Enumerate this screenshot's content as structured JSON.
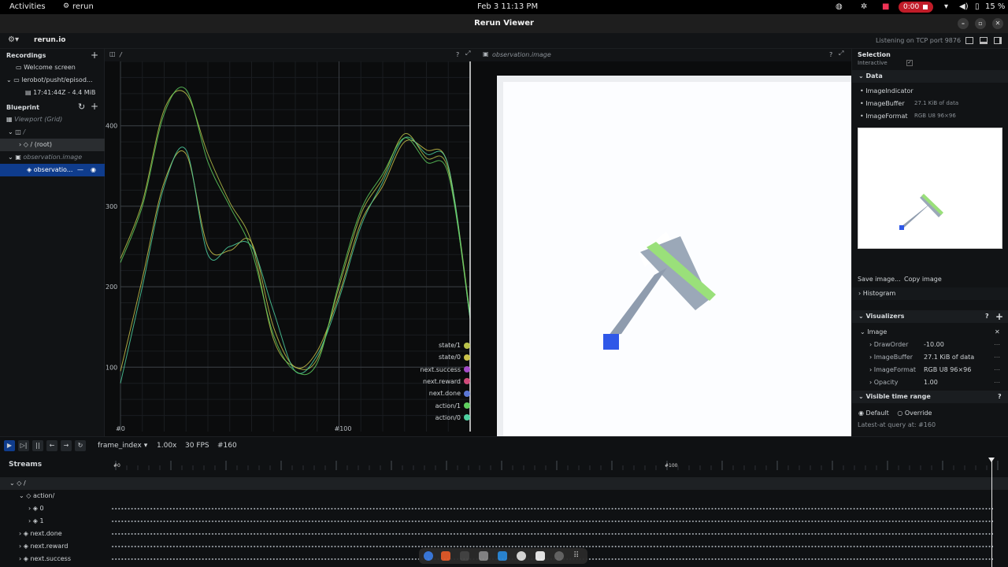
{
  "gnome": {
    "activities": "Activities",
    "app": "rerun",
    "clock": "Feb 3  11:13 PM",
    "recording_timer": "0:00",
    "battery": "15 %"
  },
  "window": {
    "title": "Rerun Viewer"
  },
  "top_panel": {
    "brand": "rerun.io",
    "status": "Listening on TCP port 9876"
  },
  "left_panel": {
    "recordings_title": "Recordings",
    "welcome": "Welcome screen",
    "recording_app": "lerobot/pusht/episod...",
    "recording_info": "17:41:44Z - 4.4 MiB",
    "blueprint_title": "Blueprint",
    "viewport": "Viewport (Grid)",
    "plot_container": "/",
    "plot_root": "/ (root)",
    "image_container": "observation.image",
    "image_entity": "observatio..."
  },
  "plot_view": {
    "tab_title": "/",
    "help": "?",
    "y_ticks": [
      "400",
      "300",
      "200",
      "100"
    ],
    "x_ticks": [
      "#0",
      "#100"
    ],
    "legend": [
      {
        "label": "state/1",
        "color": "#b9c24a"
      },
      {
        "label": "state/0",
        "color": "#c9c24a"
      },
      {
        "label": "next.success",
        "color": "#a44bc9"
      },
      {
        "label": "next.reward",
        "color": "#d04a7a"
      },
      {
        "label": "next.done",
        "color": "#5b77d6"
      },
      {
        "label": "action/1",
        "color": "#5fcf5f"
      },
      {
        "label": "action/0",
        "color": "#4ed0a0"
      }
    ]
  },
  "chart_data": {
    "type": "line",
    "x": [
      0,
      10,
      20,
      30,
      40,
      50,
      60,
      70,
      80,
      90,
      100,
      110,
      120,
      130,
      140,
      150,
      160
    ],
    "ylim": [
      20,
      480
    ],
    "xlim": [
      0,
      160
    ],
    "series": [
      {
        "name": "state/0",
        "values": [
          95,
          210,
          330,
          365,
          250,
          245,
          255,
          150,
          100,
          120,
          190,
          280,
          325,
          380,
          370,
          350,
          165
        ]
      },
      {
        "name": "state/1",
        "values": [
          235,
          305,
          420,
          440,
          365,
          305,
          255,
          135,
          100,
          110,
          200,
          290,
          335,
          390,
          360,
          345,
          160
        ]
      },
      {
        "name": "action/0",
        "values": [
          80,
          200,
          325,
          370,
          240,
          250,
          250,
          170,
          95,
          115,
          185,
          275,
          330,
          385,
          365,
          350,
          160
        ]
      },
      {
        "name": "action/1",
        "values": [
          230,
          300,
          415,
          445,
          355,
          300,
          245,
          140,
          95,
          105,
          205,
          295,
          340,
          385,
          355,
          340,
          165
        ]
      }
    ]
  },
  "image_view": {
    "tab_title": "observation.image",
    "help": "?"
  },
  "selection_panel": {
    "title": "Selection",
    "interactive_label": "Interactive",
    "data_title": "Data",
    "data_rows": [
      {
        "name": "ImageIndicator",
        "value": ""
      },
      {
        "name": "ImageBuffer",
        "value": "27.1 KiB of data"
      },
      {
        "name": "ImageFormat",
        "value": "RGB  U8  96×96"
      }
    ],
    "save_image": "Save image...",
    "copy_image": "Copy image",
    "histogram": "Histogram",
    "visualizers_title": "Visualizers",
    "visualizer_name": "Image",
    "visualizer_rows": [
      {
        "name": "DrawOrder",
        "value": "-10.00"
      },
      {
        "name": "ImageBuffer",
        "value": "27.1 KiB of data"
      },
      {
        "name": "ImageFormat",
        "value": "RGB  U8  96×96"
      },
      {
        "name": "Opacity",
        "value": "1.00"
      }
    ],
    "visible_time_range": "Visible time range",
    "default_label": "Default",
    "override_label": "Override",
    "latest_at": "Latest-at query at: #160"
  },
  "time_panel": {
    "timeline": "frame_index",
    "speed": "1.00x",
    "fps": "30 FPS",
    "current": "#160",
    "streams_title": "Streams",
    "ruler_labels": [
      "#0",
      "#100"
    ],
    "streams": [
      {
        "label": "/",
        "indent": 0
      },
      {
        "label": "action/",
        "indent": 1
      },
      {
        "label": "0",
        "indent": 2
      },
      {
        "label": "1",
        "indent": 2
      },
      {
        "label": "next.done",
        "indent": 1
      },
      {
        "label": "next.reward",
        "indent": 1
      },
      {
        "label": "next.success",
        "indent": 1
      }
    ]
  }
}
